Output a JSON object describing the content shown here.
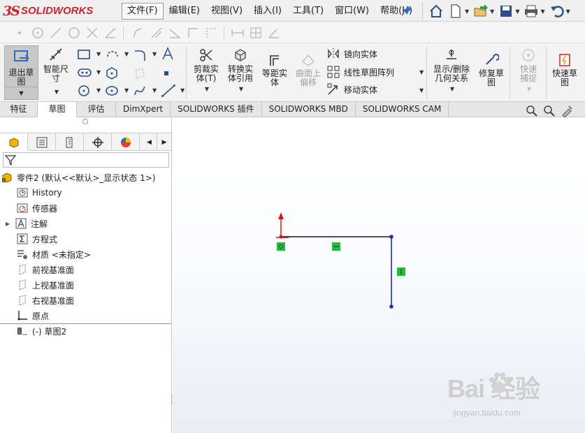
{
  "app": {
    "brand_mark": "3S",
    "brand_name": "SOLIDWORKS"
  },
  "menu": [
    "文件(F)",
    "编辑(E)",
    "视图(V)",
    "插入(I)",
    "工具(T)",
    "窗口(W)",
    "帮助(H)"
  ],
  "quick_access": [
    "home-icon",
    "new-document-icon",
    "open-icon",
    "save-icon",
    "print-icon",
    "undo-icon"
  ],
  "ribbon": {
    "exit_sketch": "退出草图",
    "smart_dimension": "智能尺寸",
    "trim": "剪裁实体(T)",
    "convert": "转换实体引用",
    "offset": "等距实体",
    "offset_surface": "曲面上偏移",
    "mirror": "镜向实体",
    "linear_pattern": "线性草图阵列",
    "move": "移动实体",
    "display_relations": "显示/删除几何关系",
    "repair": "修复草图",
    "quick_snap": "快速捕捉",
    "rapid_sketch": "快速草图"
  },
  "tabs": [
    "特征",
    "草图",
    "评估",
    "DimXpert",
    "SOLIDWORKS 插件",
    "SOLIDWORKS MBD",
    "SOLIDWORKS CAM"
  ],
  "active_tab": "草图",
  "tree": {
    "root": "零件2  (默认<<默认>_显示状态 1>)",
    "items": [
      "History",
      "传感器",
      "注解",
      "方程式",
      "材质 <未指定>",
      "前视基准面",
      "上视基准面",
      "右视基准面",
      "原点",
      "(-) 草图2"
    ]
  },
  "watermark": {
    "main": "Bai 经验",
    "sub": "jingyan.baidu.com"
  },
  "colors": {
    "accent_red": "#c9252c",
    "sketch_line": "#1a1a1a",
    "sketch_point": "#1c2fb3",
    "relation_green": "#1fbf3c",
    "axis_red": "#d41818"
  }
}
